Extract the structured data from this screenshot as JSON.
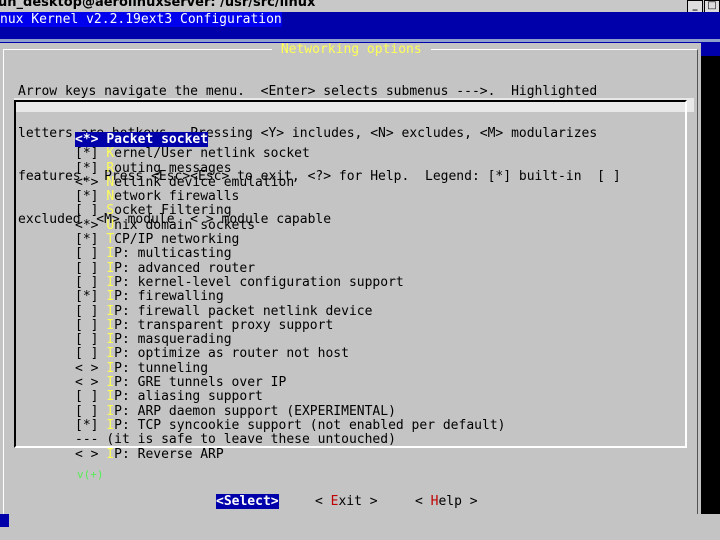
{
  "window": {
    "title": "un_desktop@aerolinuxserver: /usr/src/linux",
    "buttons": [
      "_",
      "□"
    ]
  },
  "app_title": "nux Kernel v2.2.19ext3 Configuration",
  "dialog": {
    "title": " Networking options ",
    "help_lines": [
      "Arrow keys navigate the menu.  <Enter> selects submenus --->.  Highlighted",
      "letters are hotkeys.  Pressing <Y> includes, <N> excludes, <M> modularizes",
      "features.  Press <Esc><Esc> to exit, <?> for Help.  Legend: [*] built-in  [ ]",
      "excluded  <M> module  < > module capable"
    ],
    "more_indicator": "v(+)"
  },
  "menu_items": [
    {
      "prefix": "<*> ",
      "hotkey": "P",
      "rest": "acket socket",
      "selected": true
    },
    {
      "prefix": "[*] ",
      "hotkey": "K",
      "rest": "ernel/User netlink socket",
      "selected": false
    },
    {
      "prefix": "[*] ",
      "hotkey": "R",
      "rest": "outing messages",
      "selected": false
    },
    {
      "prefix": "<*> ",
      "hotkey": "N",
      "rest": "etlink device emulation",
      "selected": false
    },
    {
      "prefix": "[*] ",
      "hotkey": "N",
      "rest": "etwork firewalls",
      "selected": false
    },
    {
      "prefix": "[ ] ",
      "hotkey": "S",
      "rest": "ocket Filtering",
      "selected": false
    },
    {
      "prefix": "<*> ",
      "hotkey": "U",
      "rest": "nix domain sockets",
      "selected": false
    },
    {
      "prefix": "[*] ",
      "hotkey": "T",
      "rest": "CP/IP networking",
      "selected": false
    },
    {
      "prefix": "[ ] ",
      "hotkey": "I",
      "rest": "P: multicasting",
      "selected": false
    },
    {
      "prefix": "[ ] ",
      "hotkey": "I",
      "rest": "P: advanced router",
      "selected": false
    },
    {
      "prefix": "[ ] ",
      "hotkey": "I",
      "rest": "P: kernel-level configuration support",
      "selected": false
    },
    {
      "prefix": "[*] ",
      "hotkey": "I",
      "rest": "P: firewalling",
      "selected": false
    },
    {
      "prefix": "[ ] ",
      "hotkey": "I",
      "rest": "P: firewall packet netlink device",
      "selected": false
    },
    {
      "prefix": "[ ] ",
      "hotkey": "I",
      "rest": "P: transparent proxy support",
      "selected": false
    },
    {
      "prefix": "[ ] ",
      "hotkey": "I",
      "rest": "P: masquerading",
      "selected": false
    },
    {
      "prefix": "[ ] ",
      "hotkey": "I",
      "rest": "P: optimize as router not host",
      "selected": false
    },
    {
      "prefix": "< > ",
      "hotkey": "I",
      "rest": "P: tunneling",
      "selected": false
    },
    {
      "prefix": "< > ",
      "hotkey": "I",
      "rest": "P: GRE tunnels over IP",
      "selected": false
    },
    {
      "prefix": "[ ] ",
      "hotkey": "I",
      "rest": "P: aliasing support",
      "selected": false
    },
    {
      "prefix": "[ ] ",
      "hotkey": "I",
      "rest": "P: ARP daemon support (EXPERIMENTAL)",
      "selected": false
    },
    {
      "prefix": "[*] ",
      "hotkey": "I",
      "rest": "P: TCP syncookie support (not enabled per default)",
      "selected": false
    },
    {
      "prefix": "--- ",
      "hotkey": "",
      "rest": "(it is safe to leave these untouched)",
      "selected": false
    },
    {
      "prefix": "< > ",
      "hotkey": "I",
      "rest": "P: Reverse ARP",
      "selected": false
    }
  ],
  "buttons": {
    "select": "<Select>",
    "exit_pre": "< ",
    "exit_hotkey": "E",
    "exit_rest": "xit >",
    "help_pre": "< ",
    "help_hotkey": "H",
    "help_rest": "elp >"
  },
  "colors": {
    "terminal_bg": "#0000aa",
    "dialog_bg": "#c4c4c4",
    "hotkey": "#ffff55",
    "title": "#ffff55"
  }
}
